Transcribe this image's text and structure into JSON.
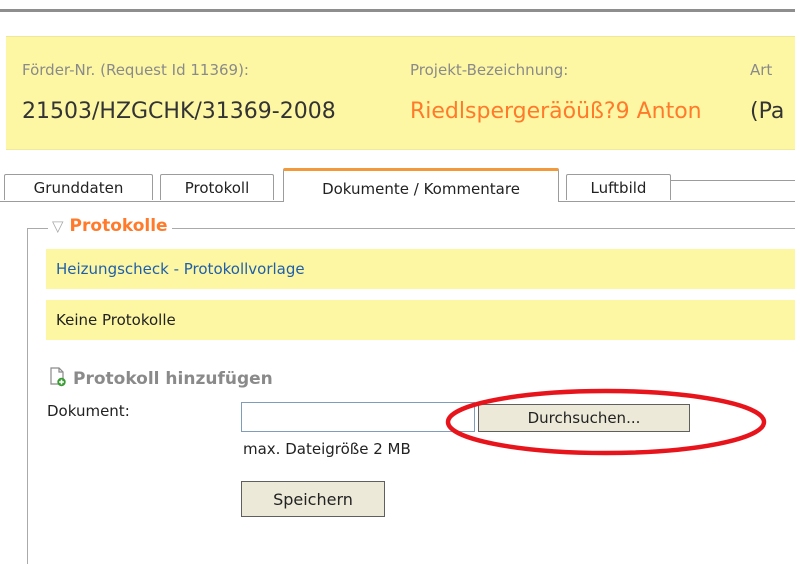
{
  "header": {
    "foerder_label": "Förder-Nr. (Request Id 11369):",
    "foerder_value": "21503/HZGCHK/31369-2008",
    "projekt_label": "Projekt-Bezeichnung:",
    "projekt_value": "Riedlspergeräöüß?9 Anton",
    "art_label": "Art",
    "art_value": "(Pa"
  },
  "tabs": [
    {
      "label": "Grunddaten",
      "active": false
    },
    {
      "label": "Protokoll",
      "active": false
    },
    {
      "label": "Dokumente / Kommentare",
      "active": true
    },
    {
      "label": "Luftbild",
      "active": false
    }
  ],
  "protokolle": {
    "title": "Protokolle",
    "template_link": "Heizungscheck - Protokollvorlage",
    "empty_text": "Keine Protokolle"
  },
  "add": {
    "heading": "Protokoll hinzufügen",
    "document_label": "Dokument:",
    "browse_label": "Durchsuchen...",
    "max_size_hint": "max. Dateigröße 2 MB",
    "save_label": "Speichern"
  },
  "colors": {
    "highlight_bg": "#fdf7a4",
    "accent_orange": "#ff7a2a",
    "link_blue": "#1f5faa",
    "annotation_red": "#e8141b"
  }
}
